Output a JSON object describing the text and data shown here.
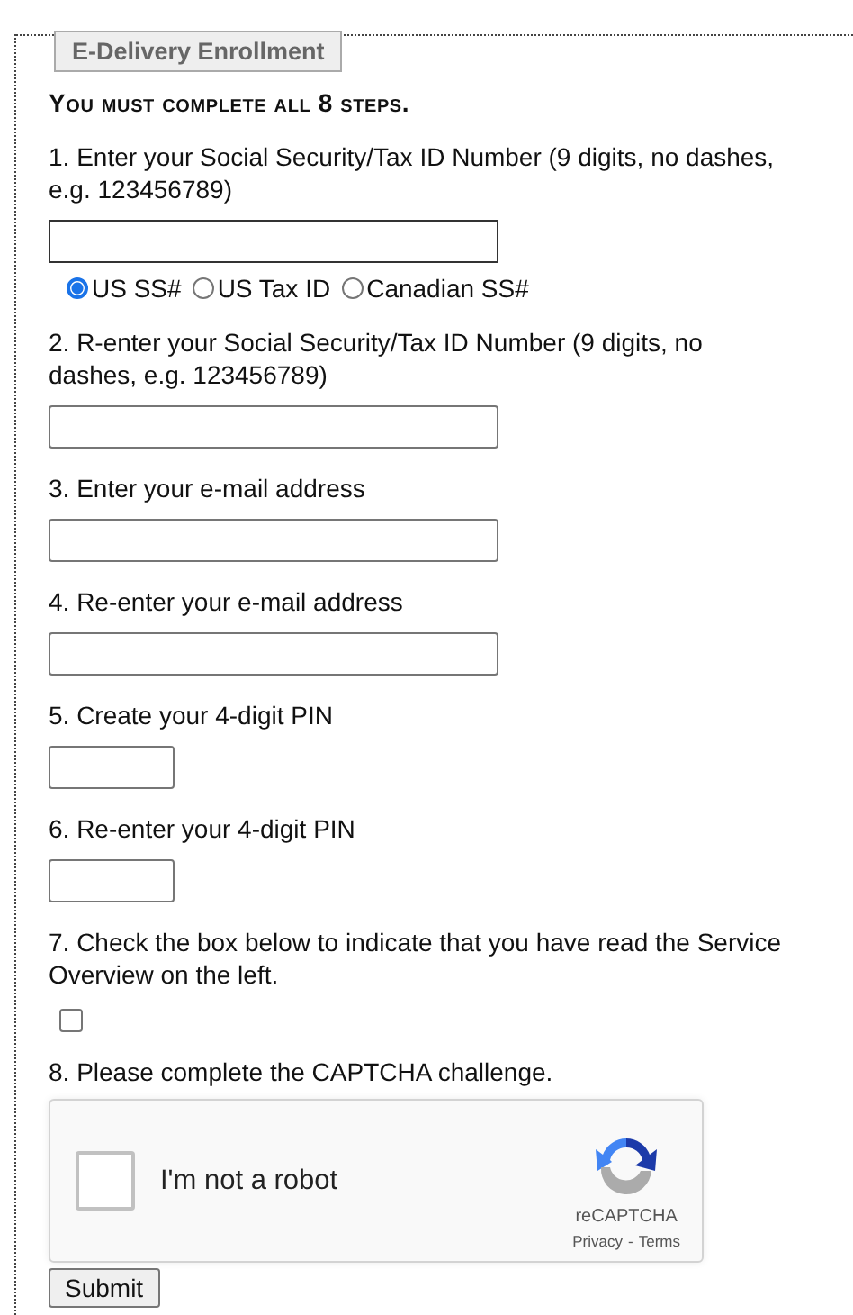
{
  "legend": "E-Delivery Enrollment",
  "heading": "You must complete all 8 steps.",
  "steps": [
    {
      "kind": "long-field",
      "label": "1. Enter your Social Security/Tax ID Number (9 digits, no dashes, e.g. 123456789)",
      "options": [
        {
          "label": "US SS#",
          "selected": true
        },
        {
          "label": "US Tax ID",
          "selected": false
        },
        {
          "label": "Canadian SS#",
          "selected": false
        }
      ]
    },
    {
      "kind": "long-field",
      "label": "2. R-enter your Social Security/Tax ID Number (9 digits, no dashes, e.g. 123456789)"
    },
    {
      "kind": "long-field",
      "label": "3. Enter your e-mail address"
    },
    {
      "kind": "long-field",
      "label": "4. Re-enter your e-mail address"
    },
    {
      "kind": "short-field",
      "label": "5. Create your 4-digit PIN"
    },
    {
      "kind": "short-field",
      "label": "6. Re-enter your 4-digit PIN"
    },
    {
      "kind": "checkbox",
      "label": "7. Check the box below to indicate that you have read the Service Overview on the left.",
      "checked": false
    },
    {
      "kind": "captcha",
      "label": "8. Please complete the CAPTCHA challenge.",
      "checked": false,
      "captcha_text": "I'm not a robot",
      "brand": "reCAPTCHA",
      "privacy": "Privacy",
      "separator": "-",
      "terms": "Terms"
    }
  ],
  "submit": "Submit"
}
